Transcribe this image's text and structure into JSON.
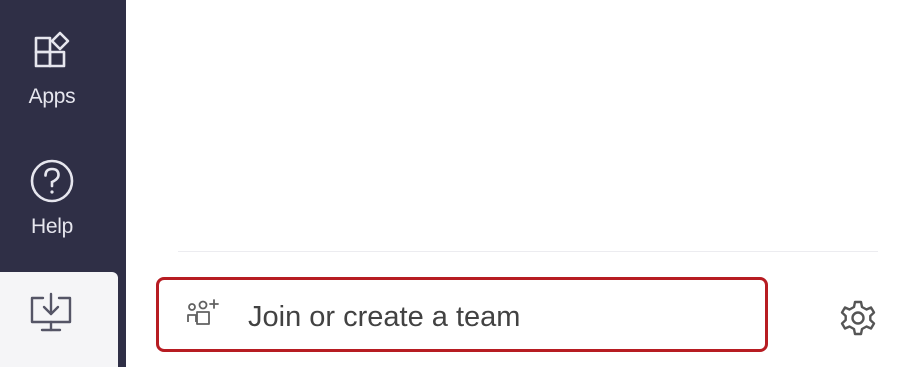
{
  "rail": {
    "items": [
      {
        "label": "Apps",
        "icon": "apps-icon"
      },
      {
        "label": "Help",
        "icon": "help-icon"
      },
      {
        "label": "",
        "icon": "download-icon"
      }
    ]
  },
  "join": {
    "label": "Join or create a team",
    "icon": "add-team-icon"
  },
  "settings": {
    "icon": "gear-icon"
  },
  "colors": {
    "rail_background": "#2f2f46",
    "highlight_border": "#b71c22"
  }
}
